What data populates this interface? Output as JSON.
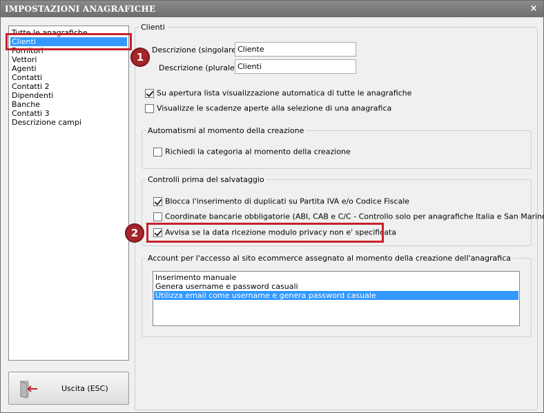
{
  "window": {
    "title": "IMPOSTAZIONI ANAGRAFICHE",
    "close_glyph": "×"
  },
  "sidebar": {
    "items": [
      {
        "label": "Tutte le anagrafiche"
      },
      {
        "label": "Clienti",
        "selected": true
      },
      {
        "label": "Fornitori"
      },
      {
        "label": "Vettori"
      },
      {
        "label": "Agenti"
      },
      {
        "label": "Contatti"
      },
      {
        "label": "Contatti 2"
      },
      {
        "label": "Dipendenti"
      },
      {
        "label": "Banche"
      },
      {
        "label": "Contatti 3"
      },
      {
        "label": "Descrizione campi"
      }
    ]
  },
  "exit_button": {
    "label": "Uscita (ESC)",
    "icon": "exit-door-icon"
  },
  "main": {
    "group_title": "Clienti",
    "desc_singolare_label": "Descrizione (singolare) :",
    "desc_singolare_value": "Cliente",
    "desc_plurale_label": "Descrizione (plurale) :",
    "desc_plurale_value": "Clienti",
    "opt_auto_view": {
      "label": "Su apertura lista visualizzazione automatica di tutte le anagrafiche",
      "checked": true
    },
    "opt_scadenze": {
      "label": "Visualizze le scadenze aperte alla selezione di una anagrafica",
      "checked": false
    }
  },
  "automatismi": {
    "title": "Automatismi al momento della creazione",
    "opt_categoria": {
      "label": "Richiedi la categoria al momento della creazione",
      "checked": false
    }
  },
  "controlli": {
    "title": "Controlli prima del salvataggio",
    "opt_duplicati": {
      "label": "Blocca l'inserimento di duplicati su Partita IVA e/o Codice Fiscale",
      "checked": true
    },
    "opt_coordinate": {
      "label": "Coordinate bancarie obbligatorie (ABI, CAB e C/C - Controllo solo per anagrafiche Italia e San Marino)",
      "checked": false
    },
    "opt_privacy": {
      "label": "Avvisa se la data ricezione modulo privacy non e' specificata",
      "checked": true
    }
  },
  "account": {
    "title": "Account per l'accesso al sito ecommerce assegnato al momento della creazione dell'anagrafica",
    "options": [
      {
        "label": "Inserimento manuale"
      },
      {
        "label": "Genera username e password casuali"
      },
      {
        "label": "Utilizza email come username e genera password casuale",
        "selected": true
      }
    ]
  },
  "annotations": {
    "badge1": "1",
    "badge2": "2",
    "highlight_color": "#c8202a",
    "badge_color": "#a5252a"
  },
  "colors": {
    "selection": "#3399ff",
    "titlebar": "#7a7a7a"
  }
}
